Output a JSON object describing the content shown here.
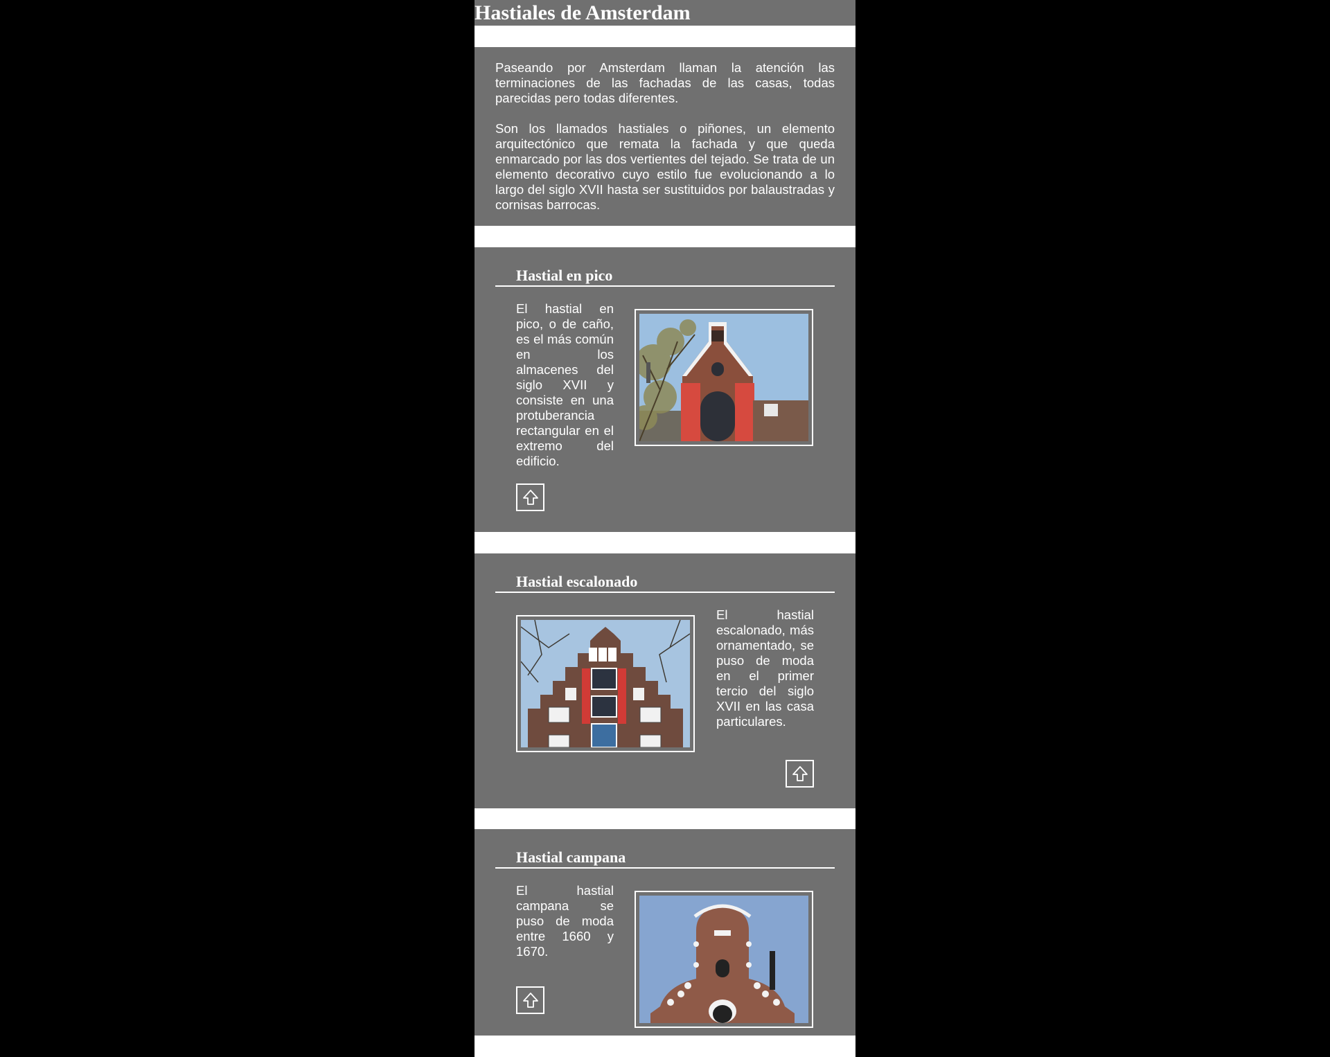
{
  "page": {
    "title": "Hastiales de Amsterdam"
  },
  "intro": {
    "paragraphs": [
      "Paseando por Amsterdam llaman la atención las terminaciones de las fachadas de las casas, todas parecidas pero todas diferentes.",
      "Son los llamados hastiales o piñones, un elemento arquitectónico que remata la fachada y que queda enmarcado por las dos vertientes del tejado. Se trata de un elemento decorativo cuyo estilo fue evolucionando a lo largo del siglo XVII hasta ser sustituidos por balaustradas y cornisas barrocas."
    ]
  },
  "sections": [
    {
      "title": "Hastial en pico",
      "text": "El hastial en pico, o de caño, es el más común en los almacenes del siglo XVII y consiste en una protuberancia rectangular en el extremo del edificio.",
      "image_alt": "spout gable photo",
      "up_icon": "up-arrow-icon"
    },
    {
      "title": "Hastial escalonado",
      "text": "El hastial escalonado, más ornamentado, se puso de moda en el primer tercio del siglo XVII en las casa particulares.",
      "image_alt": "step gable photo",
      "up_icon": "up-arrow-icon"
    },
    {
      "title": "Hastial campana",
      "text": "El hastial campana se puso de moda entre 1660 y 1670.",
      "image_alt": "bell gable photo",
      "up_icon": "up-arrow-icon"
    }
  ],
  "colors": {
    "panel": "#707070",
    "background": "#000000",
    "gap": "#ffffff",
    "text": "#ffffff"
  }
}
